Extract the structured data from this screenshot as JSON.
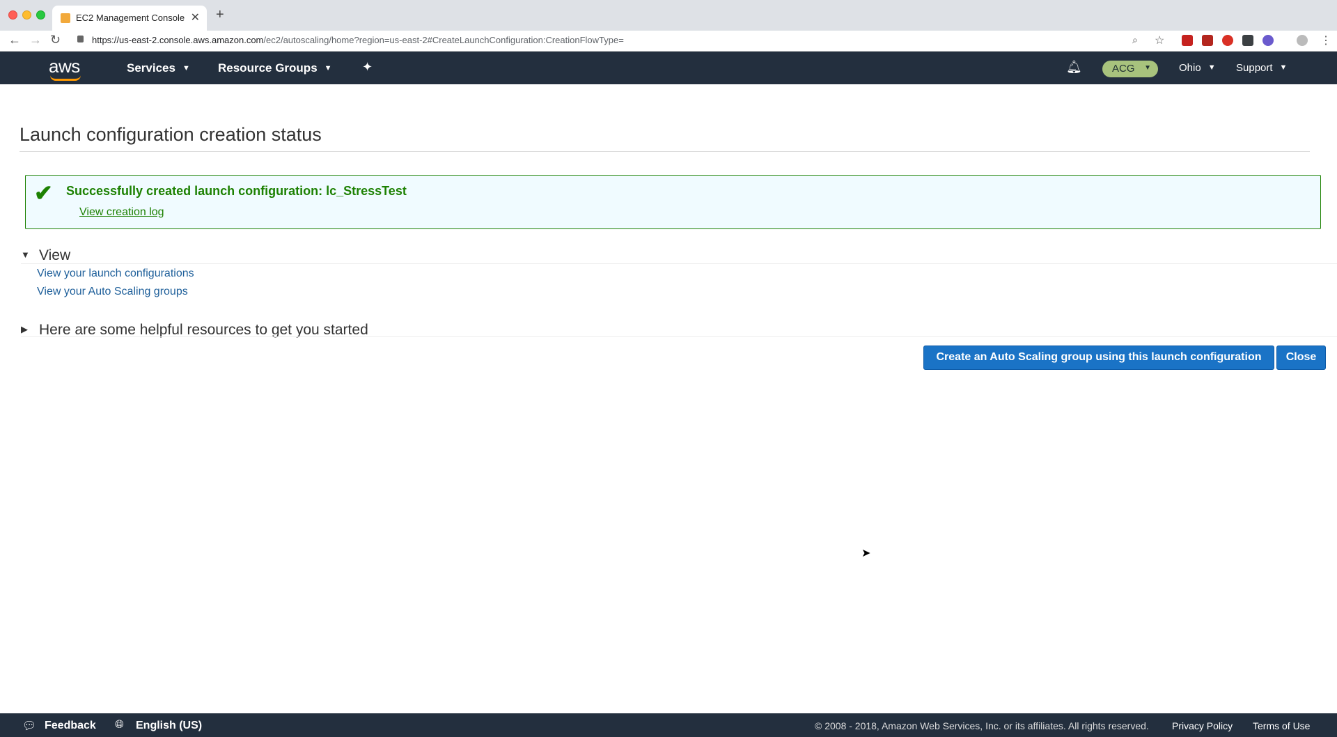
{
  "browser": {
    "tab_title": "EC2 Management Console",
    "url_host": "https://us-east-2.console.aws.amazon.com",
    "url_path": "/ec2/autoscaling/home?region=us-east-2#CreateLaunchConfiguration:CreationFlowType="
  },
  "aws_nav": {
    "logo": "aws",
    "services": "Services",
    "resource_groups": "Resource Groups",
    "account": "ACG",
    "region": "Ohio",
    "support": "Support"
  },
  "page": {
    "title": "Launch configuration creation status",
    "success_message": "Successfully created launch configuration: lc_StressTest",
    "creation_log_link": "View creation log",
    "view_section": "View",
    "view_links": [
      "View your launch configurations",
      "View your Auto Scaling groups"
    ],
    "resources_section": "Here are some helpful resources to get you started",
    "create_button": "Create an Auto Scaling group using this launch configuration",
    "close_button": "Close"
  },
  "footer": {
    "feedback": "Feedback",
    "language": "English (US)",
    "copyright": "© 2008 - 2018, Amazon Web Services, Inc. or its affiliates. All rights reserved.",
    "privacy": "Privacy Policy",
    "terms": "Terms of Use"
  },
  "colors": {
    "nav_bg": "#232f3e",
    "success_green": "#1d8102",
    "primary_button": "#1a73c6",
    "link_blue": "#1e5f9a"
  }
}
